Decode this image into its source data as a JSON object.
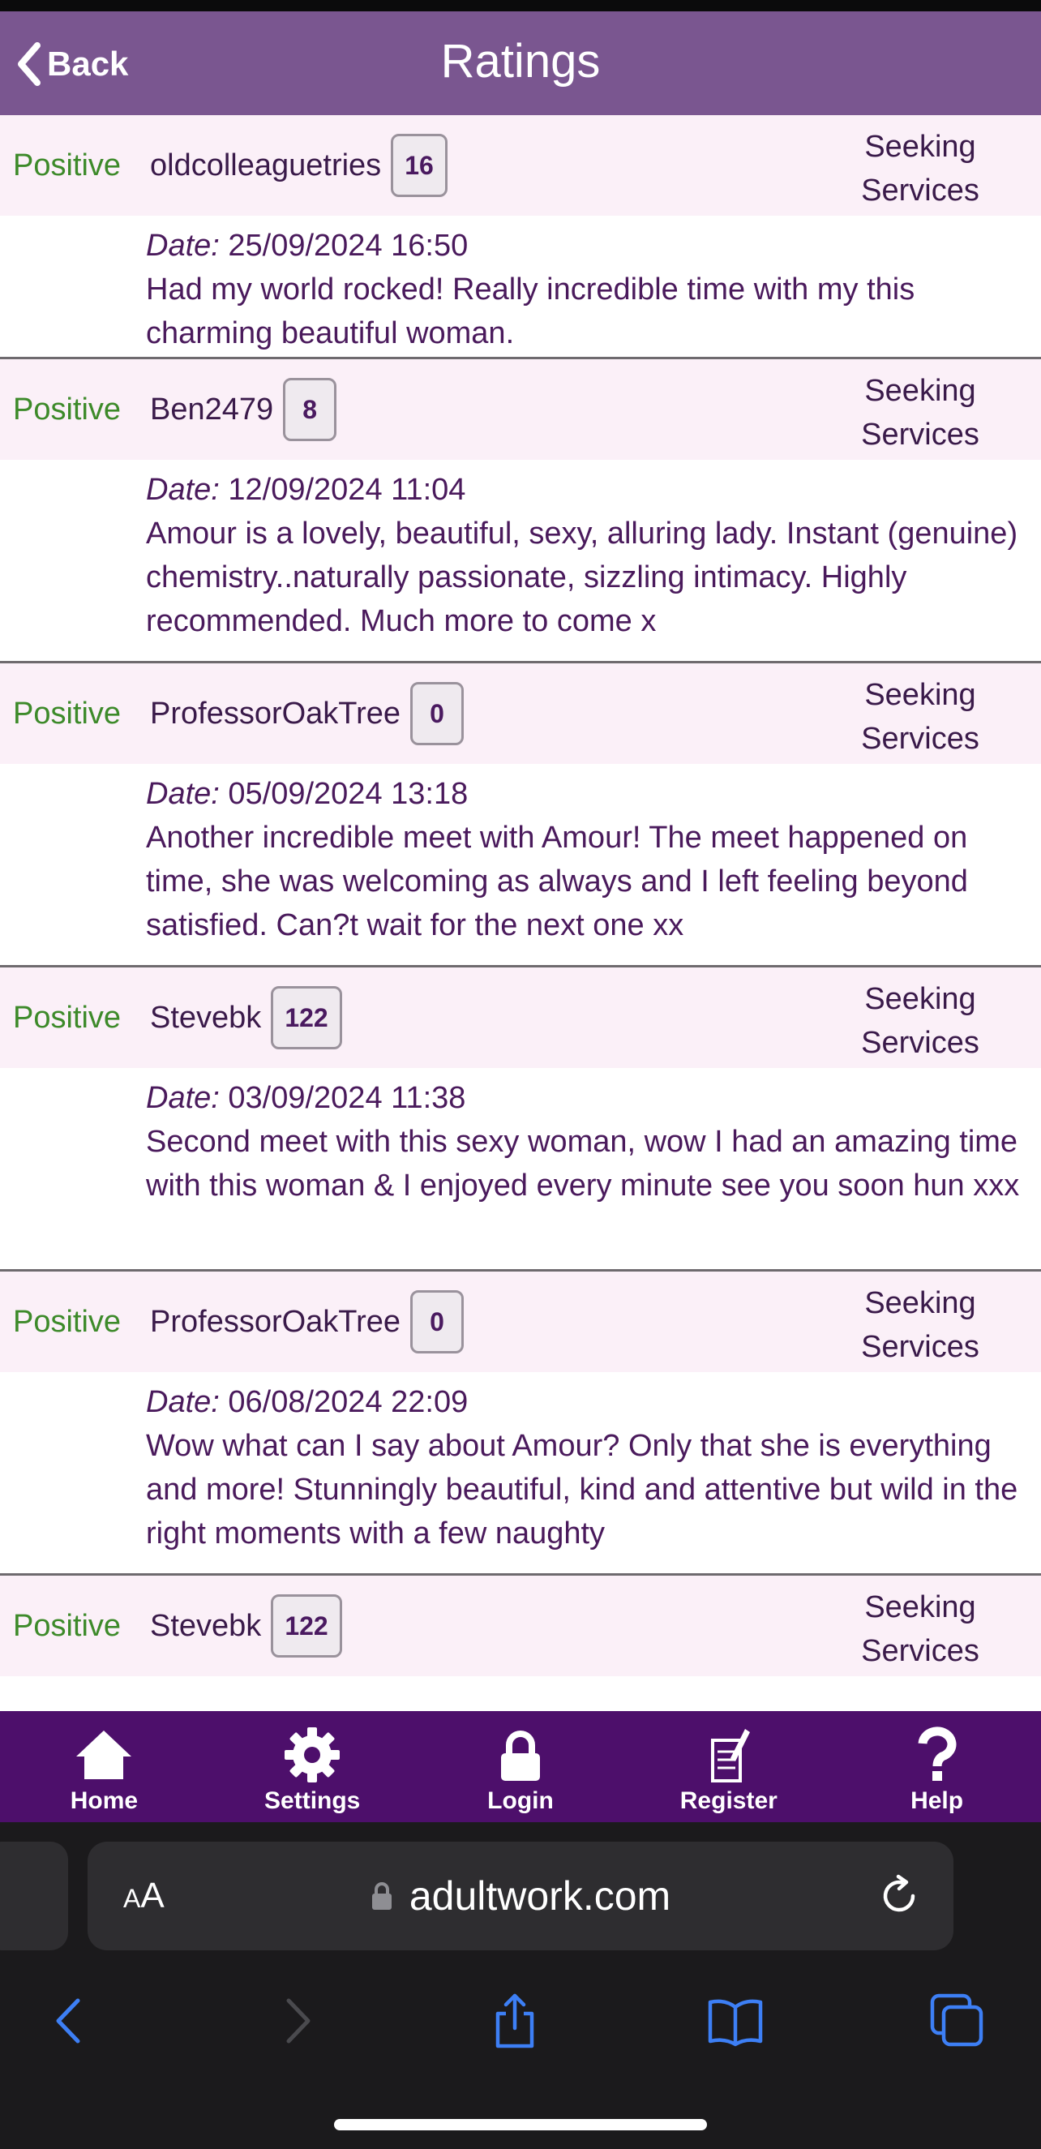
{
  "navbar": {
    "back_label": "Back",
    "title": "Ratings"
  },
  "ratings": [
    {
      "type": "Positive",
      "user": "oldcolleaguetries",
      "score": "16",
      "role": [
        "Seeking",
        "Services"
      ],
      "date_label": "Date:",
      "date": "25/09/2024 16:50",
      "text": "Had my world rocked! Really incredible time with my this charming beautiful woman."
    },
    {
      "type": "Positive",
      "user": "Ben2479",
      "score": "8",
      "role": [
        "Seeking",
        "Services"
      ],
      "date_label": "Date:",
      "date": "12/09/2024 11:04",
      "text": "Amour is a lovely, beautiful, sexy, alluring lady. Instant (genuine) chemistry..naturally passionate, sizzling intimacy. Highly recommended. Much more to come x"
    },
    {
      "type": "Positive",
      "user": "ProfessorOakTree",
      "score": "0",
      "role": [
        "Seeking",
        "Services"
      ],
      "date_label": "Date:",
      "date": "05/09/2024 13:18",
      "text": "Another incredible meet with Amour! The meet happened on time, she was welcoming as always and I left feeling beyond satisfied. Can?t wait for the next one xx"
    },
    {
      "type": "Positive",
      "user": "Stevebk",
      "score": "122",
      "role": [
        "Seeking",
        "Services"
      ],
      "date_label": "Date:",
      "date": "03/09/2024 11:38",
      "text": "Second meet with this sexy woman, wow I had an amazing time with this woman & I enjoyed every minute see you soon hun xxx"
    },
    {
      "type": "Positive",
      "user": "ProfessorOakTree",
      "score": "0",
      "role": [
        "Seeking",
        "Services"
      ],
      "date_label": "Date:",
      "date": "06/08/2024 22:09",
      "text": "Wow what can I say about Amour? Only that she is everything and more! Stunningly beautiful, kind and attentive but wild in the right moments with a few naughty"
    },
    {
      "type": "Positive",
      "user": "Stevebk",
      "score": "122",
      "role": [
        "Seeking",
        "Services"
      ],
      "date_label": "Date:",
      "date": "",
      "text": ""
    }
  ],
  "tabbar": {
    "items": [
      {
        "label": "Home",
        "icon": "home-icon"
      },
      {
        "label": "Settings",
        "icon": "gear-icon"
      },
      {
        "label": "Login",
        "icon": "lock-icon"
      },
      {
        "label": "Register",
        "icon": "register-icon"
      },
      {
        "label": "Help",
        "icon": "help-icon"
      }
    ]
  },
  "browser": {
    "text_size_label": "AA",
    "url": "adultwork.com",
    "accent_color": "#3d7ff5"
  },
  "colors": {
    "navbar": "#7a5690",
    "tabbar": "#4d0f6b",
    "positive": "#3d8a2a",
    "row_header": "#fbf0f8"
  }
}
